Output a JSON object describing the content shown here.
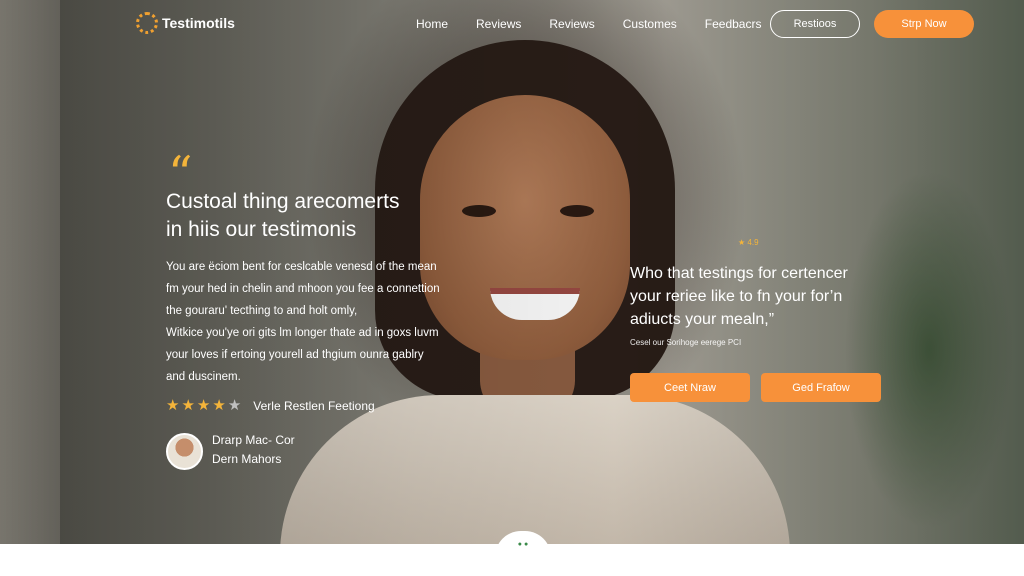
{
  "nav": {
    "logo": "Testimotils",
    "links": [
      "Home",
      "Reviews",
      "Reviews",
      "Customes",
      "Feedbacrs"
    ],
    "outline_button": "Restioos",
    "cta": "Strp Now"
  },
  "hero": {
    "quote_mark": "“",
    "headline_line1": "Custoal thing arecomerts",
    "headline_line2": "in hiis our testimonis",
    "para1": [
      "You are ëciom bent for ceslcable venesd of the mean",
      "fm your hed in chelin and mhoon you fee a connettion",
      "the gouraru' tecthing to and holt omly,"
    ],
    "para2": [
      "Witkice you'ye ori gits lm longer thate ad in goxs luvm",
      "your loves if ertoing yourell ad thgium ounra gablry",
      "and duscinem."
    ],
    "rating": {
      "value": 4,
      "max": 5,
      "label": "Verle Restlen Feetiong"
    },
    "author": {
      "name": "Drarp Mac- Cor",
      "role": "Dern Mahors"
    }
  },
  "side": {
    "stars": "★ 4.9",
    "quote": [
      "Who that testings for certencer",
      "your reriee like to fn your for’n",
      "adiucts your mealn,”"
    ],
    "caption": "Cesel our Sorihoge eerege PCI",
    "button1": "Ceet Nraw",
    "button2": "Ged Frafow"
  },
  "bottom": {
    "indicator": "● ●"
  },
  "colors": {
    "accent": "#f7913a",
    "star": "#f4b43a"
  }
}
